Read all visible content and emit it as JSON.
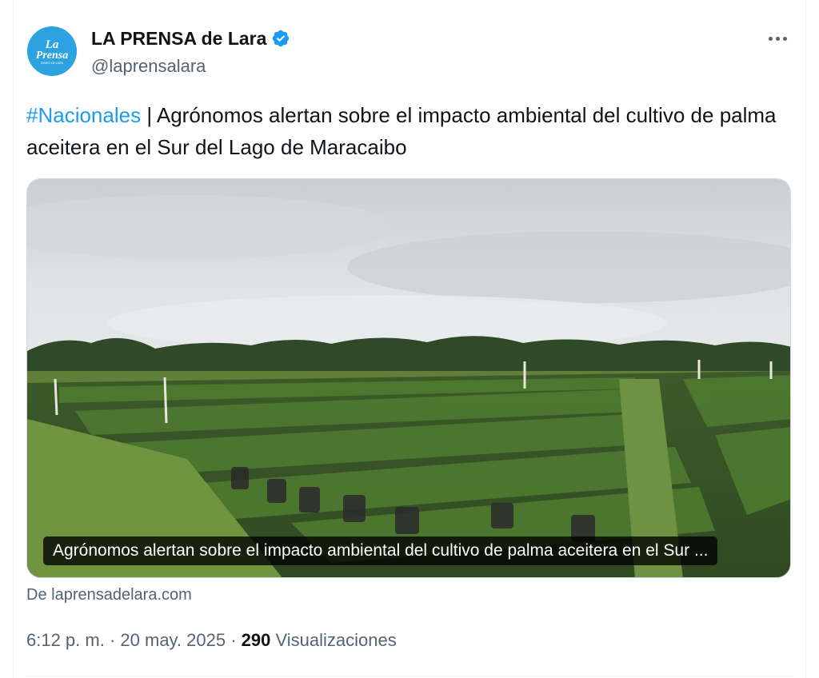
{
  "author": {
    "display_name": "LA PRENSA de Lara",
    "handle": "@laprensalara",
    "avatar_text_1": "La",
    "avatar_text_2": "Prensa",
    "avatar_text_3": "DIARIO DE LARA",
    "verified": true
  },
  "tweet": {
    "hashtag": "#Nacionales",
    "text": " | Agrónomos alertan sobre el impacto ambiental del cultivo de palma aceitera en el Sur del Lago de Maracaibo"
  },
  "card": {
    "caption": "Agrónomos alertan sobre el impacto ambiental del cultivo de palma aceitera en el Sur ...",
    "source": "De laprensadelara.com"
  },
  "meta": {
    "time": "6:12 p. m.",
    "sep1": " · ",
    "date": "20 may. 2025",
    "sep2": " · ",
    "views_count": "290",
    "views_label": " Visualizaciones"
  },
  "icons": {
    "verified": "verified-badge-icon",
    "more": "more-options-icon"
  },
  "colors": {
    "accent": "#1d9bf0",
    "text": "#0f1419",
    "secondary": "#536471",
    "avatar_bg": "#2da2e0"
  }
}
